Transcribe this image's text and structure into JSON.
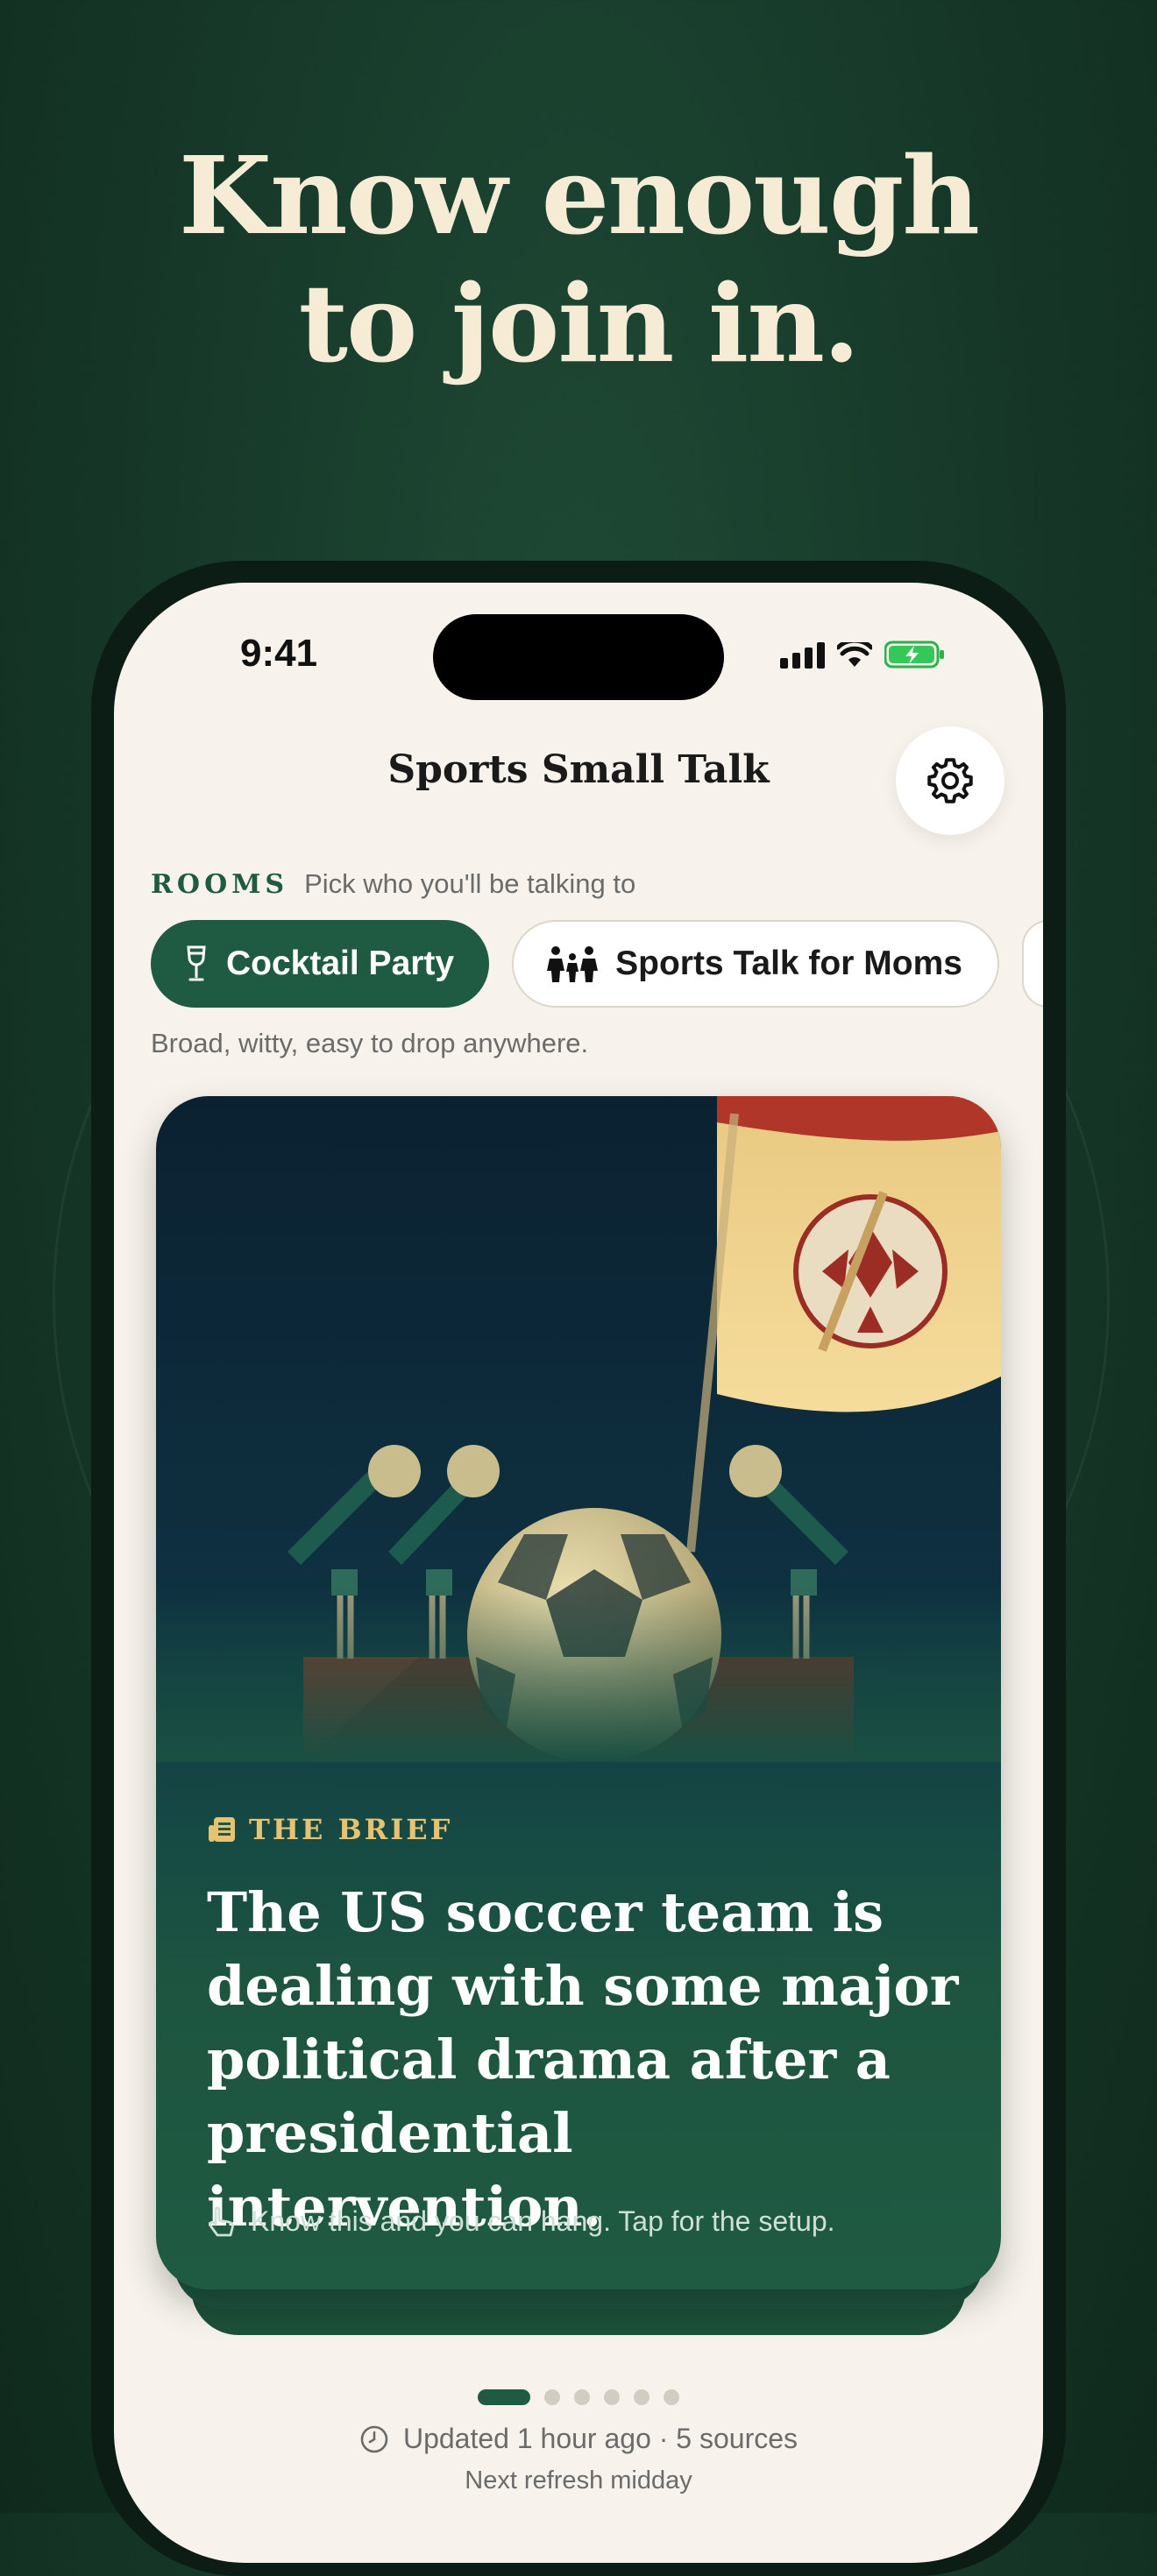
{
  "headline": {
    "line1": "Know enough",
    "line2": "to join in."
  },
  "status_bar": {
    "time": "9:41"
  },
  "nav": {
    "title": "Sports Small Talk",
    "settings_icon": "gear-icon"
  },
  "rooms": {
    "label": "ROOMS",
    "hint": "Pick who you'll be talking to",
    "chips": [
      {
        "label": "Cocktail Party",
        "icon": "wine-glass-icon",
        "selected": true
      },
      {
        "label": "Sports Talk for Moms",
        "icon": "family-icon",
        "selected": false
      }
    ],
    "description": "Broad, witty, easy to drop anywhere."
  },
  "card": {
    "kicker": "THE BRIEF",
    "kicker_icon": "newspaper-icon",
    "title": "The US soccer team is dealing with some major political drama after a presidential intervention.",
    "hint": "Know this and you can hang. Tap for the setup.",
    "hint_icon": "tap-hand-icon"
  },
  "pager": {
    "count": 6,
    "active": 1
  },
  "footer": {
    "updated": "Updated 1 hour ago · 5 sources",
    "refresh": "Next refresh midday"
  },
  "colors": {
    "background": "#173a2a",
    "accent_green": "#1f5a42",
    "headline_cream": "#f6ecd6",
    "brief_gold": "#e6c373"
  }
}
